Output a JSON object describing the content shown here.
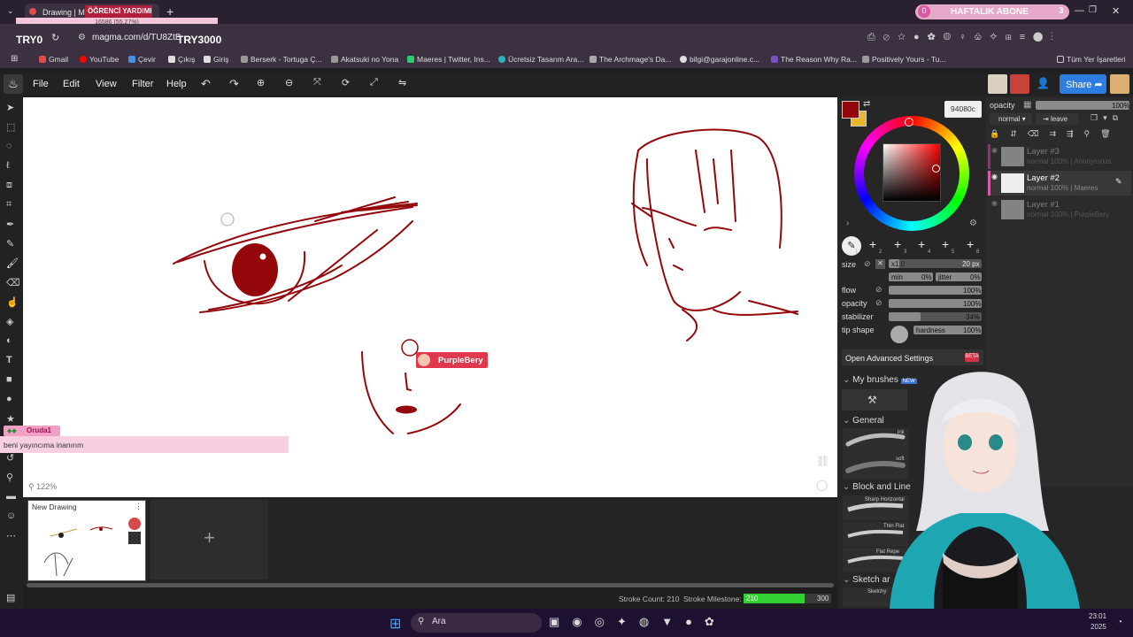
{
  "browser": {
    "tab_title": "Drawing | Magma",
    "overlay_top": "ÖĞRENCİ YARDIMI",
    "overlay_counter": "16586 (55.27%)",
    "left_label": "TRY0",
    "right_label": "TRY3000",
    "url": "magma.com/d/TU8ZtB",
    "promo": "HAFTALIK ABONE",
    "promo_left": "0",
    "promo_right": "3",
    "bookmarks": [
      "Gmail",
      "YouTube",
      "Çevir",
      "Çıkış",
      "Giriş",
      "Berserk - Tortuga Ç...",
      "Akatsuki no Yona",
      "Maeres | Twitter, Ins...",
      "Ücretsiz Tasarım Ara...",
      "The Archmage's Da...",
      "bilgi@garajonline.c...",
      "The Reason Why Ra...",
      "Positively Yours - Tu..."
    ],
    "all_bookmarks": "Tüm Yer İşaretleri"
  },
  "menu": [
    "File",
    "Edit",
    "View",
    "Filter",
    "Help"
  ],
  "share_label": "Share",
  "canvas": {
    "zoom": "122%",
    "cursor_user": "PurpleBery",
    "chat_user": "Oruda1",
    "chat_message": "beni yayıncıma inanırım",
    "stroke_count": "Stroke Count: 210",
    "stroke_milestone_label": "Stroke Milestone:",
    "stroke_value": "210",
    "stroke_target": "300",
    "stroke_progress": 0.7
  },
  "drawing_tab": "New Drawing",
  "color": {
    "hex": "94080c",
    "primary": "#94080c",
    "secondary": "#e8b62a"
  },
  "layers_panel": {
    "opacity_label": "opacity",
    "opacity_value": "100%",
    "blend": "normal",
    "leave": "leave",
    "layers": [
      {
        "name": "Layer #3",
        "sub": "normal 100% | Anonymous",
        "active": false
      },
      {
        "name": "Layer #2",
        "sub": "normal 100% | Maeres",
        "active": true
      },
      {
        "name": "Layer #1",
        "sub": "normal 100% | PurpleBery",
        "active": false
      }
    ]
  },
  "brush": {
    "size_label": "size",
    "size_mult": "x1.0",
    "size_value": "20 px",
    "min_label": "min",
    "min_value": "0%",
    "jitter_label": "jitter",
    "jitter_value": "0%",
    "flow_label": "flow",
    "flow_value": "100%",
    "opacity_label": "opacity",
    "opacity_value": "100%",
    "stabilizer_label": "stabilizer",
    "stabilizer_value": "34%",
    "stabilizer_level": 0.34,
    "tip_label": "tip shape",
    "hardness_label": "hardness",
    "hardness_value": "100%",
    "slots": [
      "1",
      "2",
      "3",
      "4",
      "5",
      "6"
    ],
    "advanced": "Open Advanced Settings",
    "beta": "BETA"
  },
  "brush_sections": {
    "my_brushes": "My brushes",
    "new_badge": "NEW",
    "general": "General",
    "ink": "ink",
    "soft": "soft",
    "block": "Block and Line",
    "sharp": "Sharp Horizontal",
    "thin": "Thin Flat",
    "flat": "Flat Repe",
    "sketch": "Sketch ar",
    "sketchy": "Sketchy"
  },
  "taskbar": {
    "search": "Ara",
    "time": "23:01",
    "year": "2025"
  }
}
